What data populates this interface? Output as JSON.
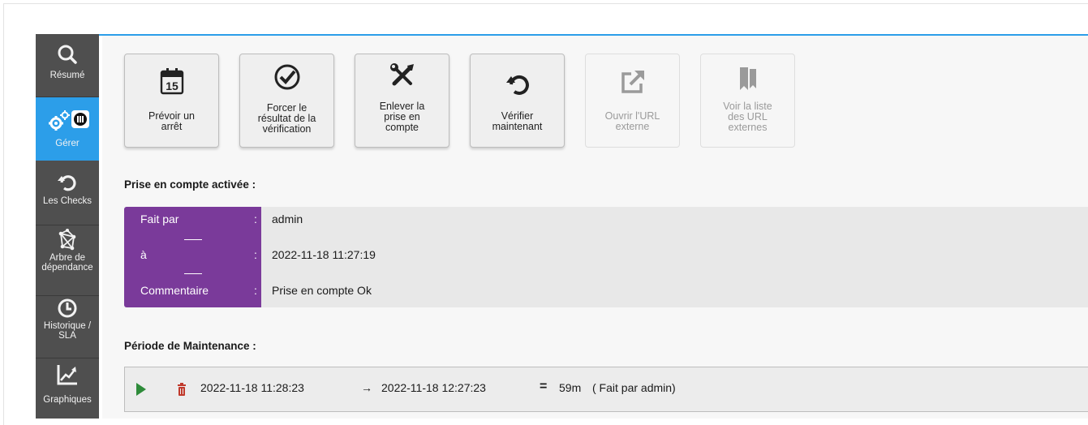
{
  "sidebar": {
    "items": [
      {
        "label": "Résumé",
        "icon": "search-icon"
      },
      {
        "label": "Gérer",
        "icon": "gears-icon",
        "badge_icon": "maintenance-badge-icon"
      },
      {
        "label": "Les Checks",
        "icon": "refresh-icon"
      },
      {
        "label": "Arbre de dépendance",
        "icon": "network-tree-icon"
      },
      {
        "label": "Historique / SLA",
        "icon": "clock-icon"
      },
      {
        "label": "Graphiques",
        "icon": "chart-icon"
      }
    ],
    "active": "Gérer",
    "colors": {
      "background": "#4f4f4f",
      "active": "#2c9ee9"
    }
  },
  "actions": [
    {
      "label": "Prévoir un\narrêt",
      "icon": "calendar-icon",
      "enabled": true
    },
    {
      "label": "Forcer le\nrésultat de la\nvérification",
      "icon": "check-circle-icon",
      "enabled": true
    },
    {
      "label": "Enlever la\nprise en\ncompte",
      "icon": "tools-icon",
      "enabled": true
    },
    {
      "label": "Vérifier\nmaintenant",
      "icon": "refresh-icon",
      "enabled": true
    },
    {
      "label": "Ouvrir l'URL\nexterne",
      "icon": "external-link-icon",
      "enabled": false
    },
    {
      "label": "Voir la liste\ndes URL\nexternes",
      "icon": "bookmarks-icon",
      "enabled": false
    }
  ],
  "acknowledgement": {
    "title": "Prise en compte activée :",
    "rows": [
      {
        "key": "Fait par",
        "sep": ":",
        "value": "admin"
      },
      {
        "key": "à",
        "sep": ":",
        "value": "2022-11-18 11:27:19"
      },
      {
        "key": "Commentaire",
        "sep": ":",
        "value": "Prise en compte Ok"
      }
    ],
    "accent_color": "#7a3a9a"
  },
  "maintenance": {
    "title": "Période de Maintenance :",
    "start": "2022-11-18 11:28:23",
    "arrow": "→",
    "end": "2022-11-18 12:27:23",
    "equals": "=",
    "duration": "59m",
    "by": "( Fait par admin)",
    "play_color": "#2e8b3a",
    "delete_color": "#c0392b"
  }
}
